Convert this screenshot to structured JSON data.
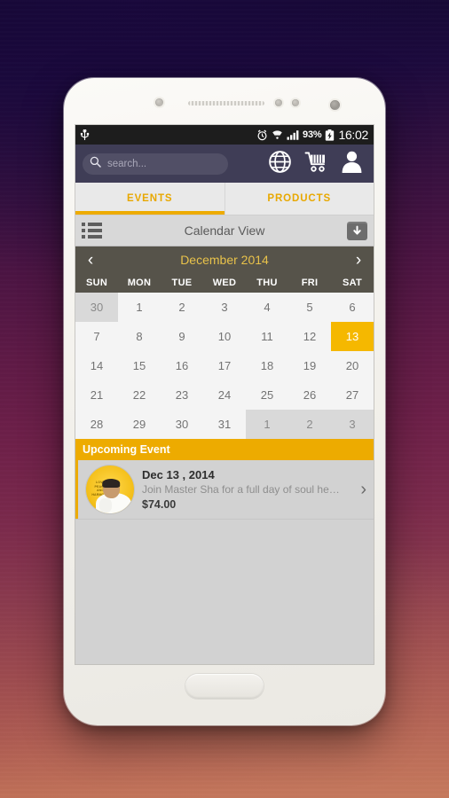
{
  "status_bar": {
    "usb_icon": "usb-icon",
    "alarm_icon": "alarm-icon",
    "wifi_icon": "wifi-icon",
    "signal_icon": "signal-bars-icon",
    "battery_percent": "93%",
    "battery_icon": "battery-charging-icon",
    "time": "16:02"
  },
  "nav": {
    "search_placeholder": "search...",
    "search_value": "",
    "search_icon": "search-icon",
    "globe_icon": "globe-icon",
    "cart_icon": "shopping-cart-icon",
    "profile_icon": "user-profile-icon"
  },
  "tabs": [
    {
      "label": "EVENTS",
      "active": true
    },
    {
      "label": "PRODUCTS",
      "active": false
    }
  ],
  "view_bar": {
    "list_icon": "list-view-icon",
    "title": "Calendar View",
    "download_icon": "download-icon"
  },
  "calendar": {
    "prev_label": "‹",
    "next_label": "›",
    "month_label": "December 2014",
    "weekdays": [
      "SUN",
      "MON",
      "TUE",
      "WED",
      "THU",
      "FRI",
      "SAT"
    ],
    "rows": [
      [
        {
          "d": "30",
          "state": "out"
        },
        {
          "d": "1",
          "state": "in"
        },
        {
          "d": "2",
          "state": "in"
        },
        {
          "d": "3",
          "state": "in"
        },
        {
          "d": "4",
          "state": "in"
        },
        {
          "d": "5",
          "state": "in"
        },
        {
          "d": "6",
          "state": "in"
        }
      ],
      [
        {
          "d": "7",
          "state": "in"
        },
        {
          "d": "8",
          "state": "in"
        },
        {
          "d": "9",
          "state": "in"
        },
        {
          "d": "10",
          "state": "in"
        },
        {
          "d": "11",
          "state": "in"
        },
        {
          "d": "12",
          "state": "in"
        },
        {
          "d": "13",
          "state": "today"
        }
      ],
      [
        {
          "d": "14",
          "state": "in"
        },
        {
          "d": "15",
          "state": "in"
        },
        {
          "d": "16",
          "state": "in"
        },
        {
          "d": "17",
          "state": "in"
        },
        {
          "d": "18",
          "state": "in"
        },
        {
          "d": "19",
          "state": "in"
        },
        {
          "d": "20",
          "state": "in"
        }
      ],
      [
        {
          "d": "21",
          "state": "in"
        },
        {
          "d": "22",
          "state": "in"
        },
        {
          "d": "23",
          "state": "in"
        },
        {
          "d": "24",
          "state": "in"
        },
        {
          "d": "25",
          "state": "in"
        },
        {
          "d": "26",
          "state": "in"
        },
        {
          "d": "27",
          "state": "in"
        }
      ],
      [
        {
          "d": "28",
          "state": "in"
        },
        {
          "d": "29",
          "state": "in"
        },
        {
          "d": "30",
          "state": "in"
        },
        {
          "d": "31",
          "state": "in"
        },
        {
          "d": "1",
          "state": "out"
        },
        {
          "d": "2",
          "state": "out"
        },
        {
          "d": "3",
          "state": "out"
        }
      ]
    ]
  },
  "upcoming": {
    "header": "Upcoming Event",
    "event": {
      "date": "Dec 13 , 2014",
      "description": "Join Master Sha for a full day of soul he…",
      "price": "$74.00",
      "thumb_caption": "LOVE PEACE AND HARMONY",
      "thumb_icon": "event-avatar",
      "chevron": "›"
    }
  },
  "colors": {
    "accent_yellow": "#edab00",
    "today_yellow": "#f5b800",
    "nav_purple": "#3f3d56",
    "month_header": "#56534a",
    "screen_bg": "#d2d2d2"
  }
}
